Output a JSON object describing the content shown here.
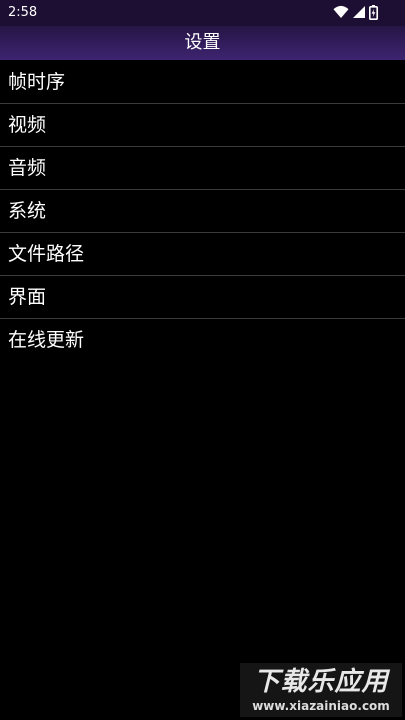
{
  "status_bar": {
    "time": "2:58",
    "icons": [
      "wifi-icon",
      "signal-icon",
      "battery-icon"
    ]
  },
  "app_bar": {
    "title": "设置"
  },
  "menu": {
    "items": [
      {
        "label": "帧时序"
      },
      {
        "label": "视频"
      },
      {
        "label": "音频"
      },
      {
        "label": "系统"
      },
      {
        "label": "文件路径"
      },
      {
        "label": "界面"
      },
      {
        "label": "在线更新"
      }
    ]
  },
  "watermark": {
    "main": "下载乐应用",
    "sub": "www.xiazainiao.com"
  },
  "colors": {
    "background": "#000000",
    "status_bar": "#1d0f33",
    "app_bar_top": "#261546",
    "app_bar_bottom": "#3e2470",
    "divider": "#3a3a3a",
    "text": "#ffffff"
  }
}
